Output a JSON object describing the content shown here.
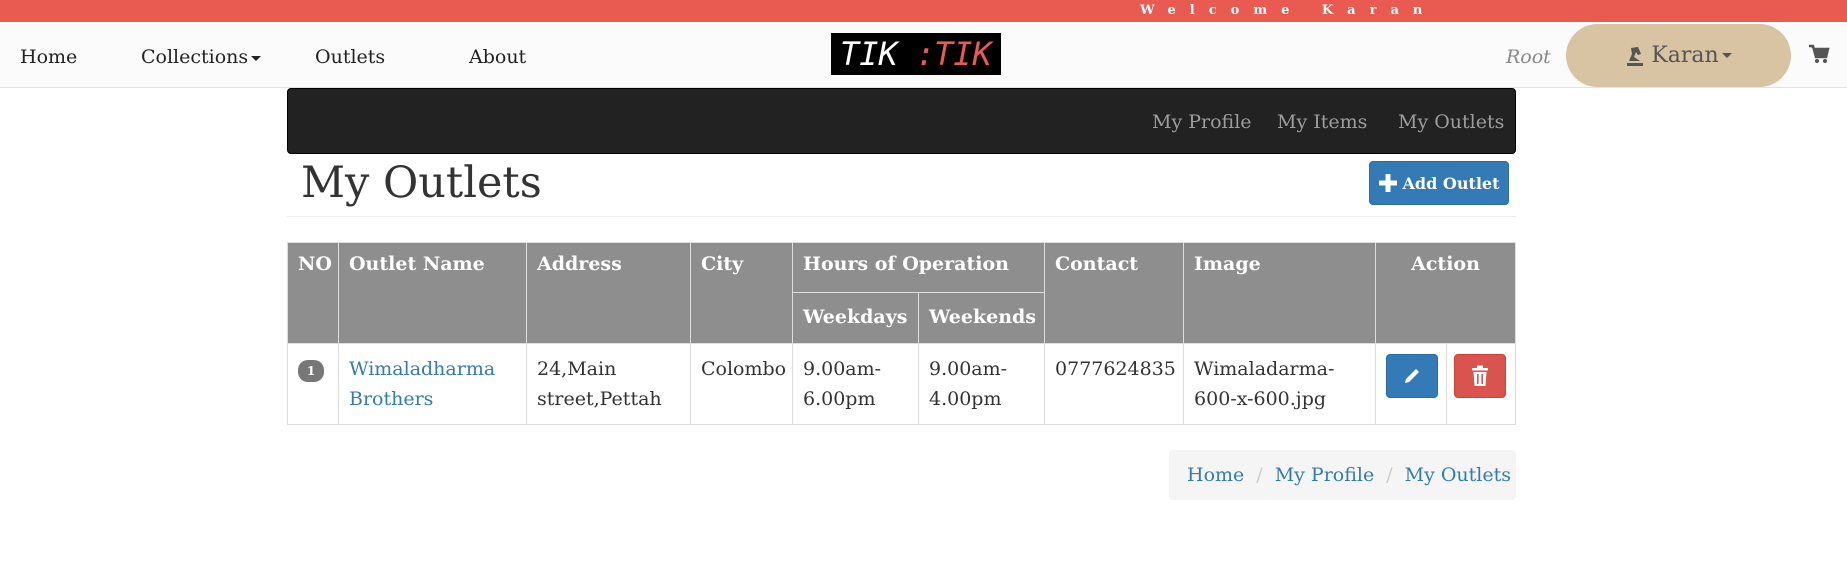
{
  "welcome": {
    "text": "Welcome  Karan"
  },
  "nav": {
    "home": "Home",
    "collections": "Collections",
    "outlets": "Outlets",
    "about": "About",
    "logo_left": "TIK",
    "logo_sep": ":",
    "logo_right": "TIK",
    "root_label": "Root",
    "user": "Karan",
    "cart_icon": "cart-icon"
  },
  "subnav": {
    "profile": "My Profile",
    "items": "My Items",
    "outlets": "My Outlets"
  },
  "page": {
    "title": "My Outlets",
    "add_button": "Add Outlet"
  },
  "table": {
    "headers": {
      "no": "NO",
      "name": "Outlet Name",
      "address": "Address",
      "city": "City",
      "hours": "Hours of Operation",
      "weekdays": "Weekdays",
      "weekends": "Weekends",
      "contact": "Contact",
      "image": "Image",
      "action": "Action"
    },
    "rows": [
      {
        "no": "1",
        "name": "Wimaladharma Brothers",
        "address": "24,Main street,Pettah",
        "city": "Colombo",
        "weekdays": "9.00am-6.00pm",
        "weekends": "9.00am-4.00pm",
        "contact": "0777624835",
        "image": "Wimaladarma-600-x-600.jpg"
      }
    ]
  },
  "breadcrumb": {
    "home": "Home",
    "profile": "My Profile",
    "outlets": "My Outlets"
  },
  "colors": {
    "accent_red": "#e95a50",
    "primary": "#337ab7",
    "danger": "#d9534f",
    "pill": "#d8c3a2"
  }
}
